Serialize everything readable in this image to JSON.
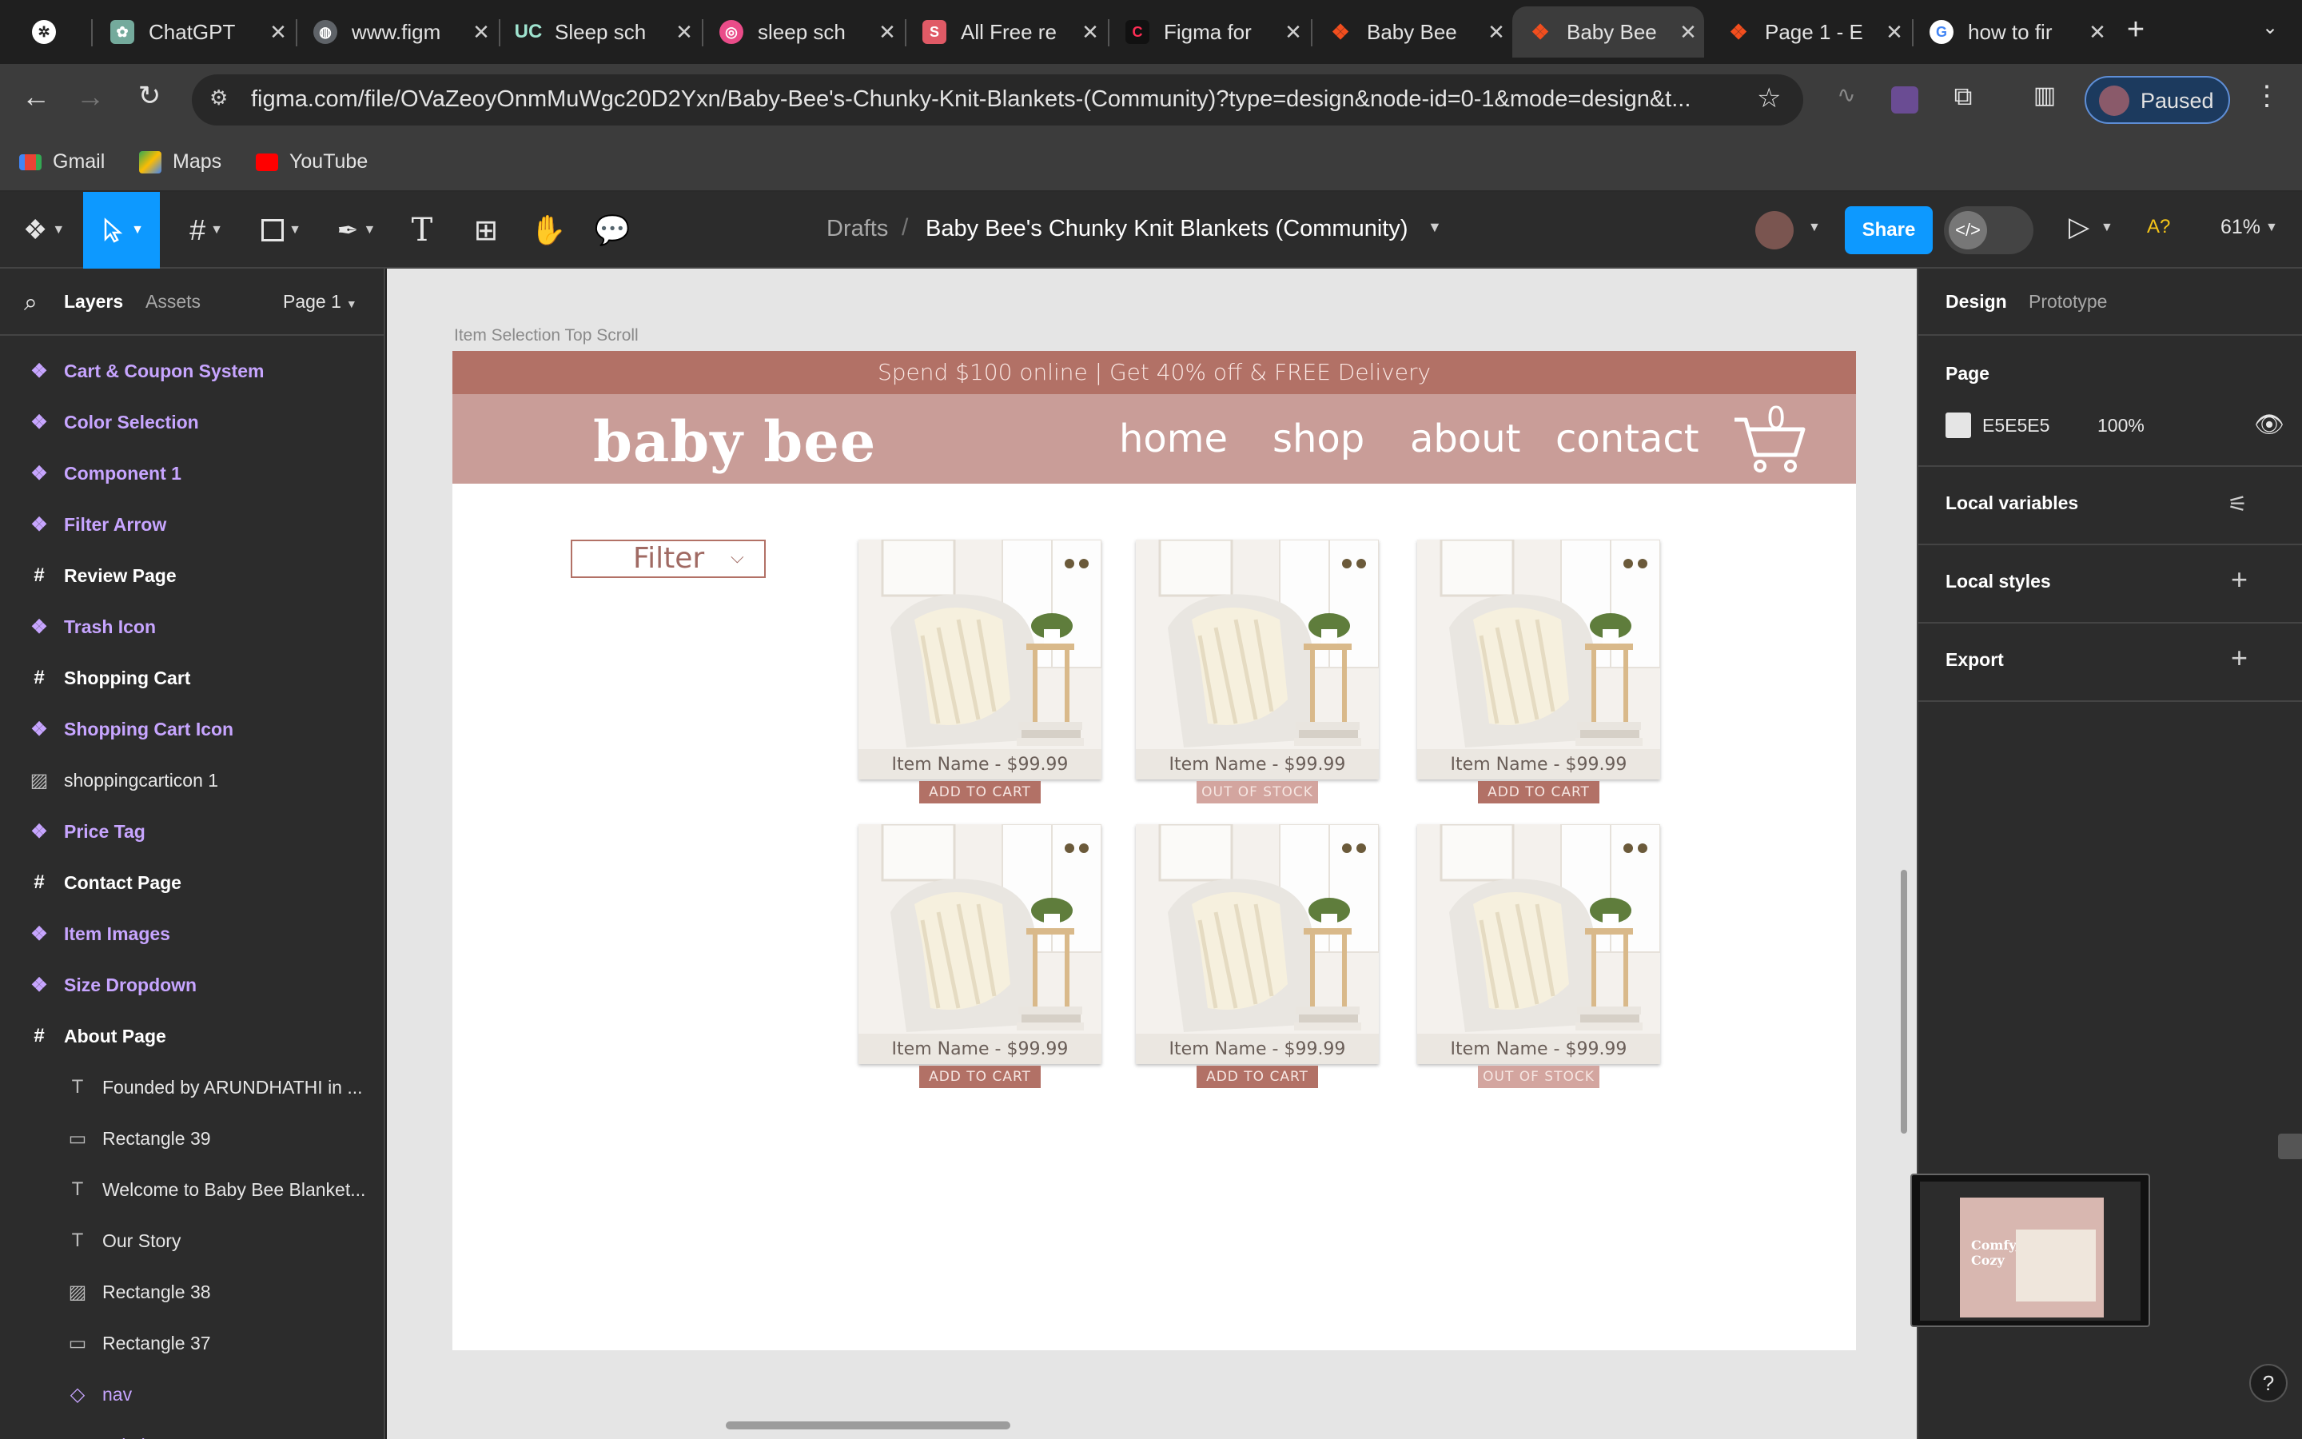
{
  "browser": {
    "tabs": [
      {
        "title": "",
        "icon": "perplexity",
        "color": "#ffffff"
      },
      {
        "title": "ChatGPT",
        "icon": "chatgpt",
        "color": "#74aa9c"
      },
      {
        "title": "www.figm",
        "icon": "globe",
        "color": "#9aa0a6"
      },
      {
        "title": "Sleep sch",
        "icon": "uc",
        "color": "#1f6f5f"
      },
      {
        "title": "sleep sch",
        "icon": "dribbble",
        "color": "#ea4c89"
      },
      {
        "title": "All Free re",
        "icon": "s-logo",
        "color": "#e05a66"
      },
      {
        "title": "Figma for",
        "icon": "c-logo",
        "color": "#111111"
      },
      {
        "title": "Baby Bee",
        "icon": "figma",
        "color": "#f24e1e"
      },
      {
        "title": "Baby Bee",
        "icon": "figma",
        "color": "#f24e1e"
      },
      {
        "title": "Page 1 - E",
        "icon": "figma",
        "color": "#f24e1e"
      },
      {
        "title": "how to fir",
        "icon": "google",
        "color": "#4285f4"
      }
    ],
    "new_tab": "+",
    "url": "figma.com/file/OVaZeoyOnmMuWgc20D2Yxn/Baby-Bee's-Chunky-Knit-Blankets-(Community)?type=design&node-id=0-1&mode=design&t...",
    "profile_status": "Paused",
    "bookmarks": [
      {
        "label": "Gmail",
        "icon": "gmail"
      },
      {
        "label": "Maps",
        "icon": "maps"
      },
      {
        "label": "YouTube",
        "icon": "youtube"
      }
    ]
  },
  "figma": {
    "breadcrumb_root": "Drafts",
    "breadcrumb_sep": "/",
    "file_name": "Baby Bee's Chunky Knit Blankets (Community)",
    "share_label": "Share",
    "zoom": "61%",
    "a_label": "A?"
  },
  "left_panel": {
    "tabs": {
      "layers": "Layers",
      "assets": "Assets"
    },
    "page_select": "Page 1",
    "layers": [
      {
        "name": "Cart & Coupon System",
        "kind": "comp",
        "icon": "component-icon"
      },
      {
        "name": "Color Selection",
        "kind": "comp",
        "icon": "component-icon"
      },
      {
        "name": "Component 1",
        "kind": "comp",
        "icon": "component-icon"
      },
      {
        "name": "Filter Arrow",
        "kind": "comp",
        "icon": "component-icon"
      },
      {
        "name": "Review Page",
        "kind": "frame",
        "icon": "frame-icon"
      },
      {
        "name": "Trash Icon",
        "kind": "comp",
        "icon": "component-icon"
      },
      {
        "name": "Shopping Cart",
        "kind": "frame",
        "icon": "frame-icon"
      },
      {
        "name": "Shopping Cart Icon",
        "kind": "comp",
        "icon": "component-icon"
      },
      {
        "name": "shoppingcarticon 1",
        "kind": "plain",
        "icon": "image-icon"
      },
      {
        "name": "Price Tag",
        "kind": "comp",
        "icon": "component-icon"
      },
      {
        "name": "Contact Page",
        "kind": "frame",
        "icon": "frame-icon"
      },
      {
        "name": "Item Images",
        "kind": "comp",
        "icon": "component-icon"
      },
      {
        "name": "Size Dropdown",
        "kind": "comp",
        "icon": "component-icon"
      },
      {
        "name": "About Page",
        "kind": "frame",
        "icon": "frame-icon"
      },
      {
        "name": "Founded by ARUNDHATHI in ...",
        "kind": "plain child",
        "icon": "text-icon"
      },
      {
        "name": "Rectangle 39",
        "kind": "plain child",
        "icon": "rectangle-icon"
      },
      {
        "name": "Welcome to Baby Bee Blanket...",
        "kind": "plain child",
        "icon": "text-icon"
      },
      {
        "name": "Our Story",
        "kind": "plain child",
        "icon": "text-icon"
      },
      {
        "name": "Rectangle 38",
        "kind": "plain child",
        "icon": "image-icon"
      },
      {
        "name": "Rectangle 37",
        "kind": "plain child",
        "icon": "rectangle-icon"
      },
      {
        "name": "nav",
        "kind": "inst child",
        "icon": "instance-icon"
      },
      {
        "name": "sale banner",
        "kind": "inst child",
        "icon": "instance-icon"
      }
    ]
  },
  "canvas": {
    "frame_label": "Item Selection Top Scroll",
    "promo": "Spend $100 online | Get 40% off & FREE Delivery",
    "logo": "baby bee",
    "nav": [
      "home",
      "shop",
      "about",
      "contact"
    ],
    "cart_count": "0",
    "filter_label": "Filter",
    "products": [
      {
        "name": "Item Name - $99.99",
        "button": "ADD TO CART",
        "stock": "in"
      },
      {
        "name": "Item Name - $99.99",
        "button": "OUT OF STOCK",
        "stock": "out"
      },
      {
        "name": "Item Name - $99.99",
        "button": "ADD TO CART",
        "stock": "in"
      },
      {
        "name": "Item Name - $99.99",
        "button": "ADD TO CART",
        "stock": "in"
      },
      {
        "name": "Item Name - $99.99",
        "button": "ADD TO CART",
        "stock": "in"
      },
      {
        "name": "Item Name - $99.99",
        "button": "OUT OF STOCK",
        "stock": "out"
      }
    ],
    "colors": {
      "brand_dark": "#b27166",
      "brand_light": "#c99d98",
      "canvas_bg": "#e5e5e5"
    }
  },
  "right_panel": {
    "tabs": {
      "design": "Design",
      "prototype": "Prototype"
    },
    "page_heading": "Page",
    "page_color_hex": "E5E5E5",
    "page_opacity": "100%",
    "local_variables": "Local variables",
    "local_styles": "Local styles",
    "export": "Export"
  },
  "help": "?",
  "minimap_text": "Comfy, Cozy"
}
